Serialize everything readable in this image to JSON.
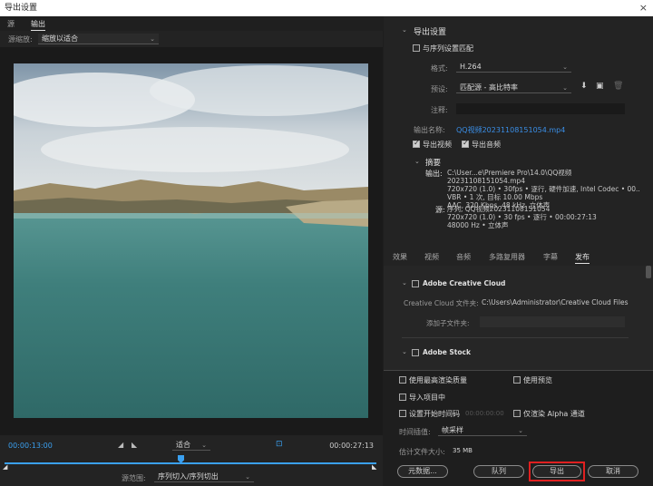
{
  "window": {
    "title": "导出设置",
    "close": "×"
  },
  "left": {
    "tabs": [
      "源",
      "输出"
    ],
    "source_scale_label": "源缩放:",
    "source_scale_value": "缩放以适合",
    "timecode_start": "00:00:13:00",
    "timecode_end": "00:00:27:13",
    "fit_value": "适合",
    "range_label": "源范围:",
    "range_value": "序列切入/序列切出"
  },
  "export": {
    "section_title": "导出设置",
    "match_sequence": "与序列设置匹配",
    "format_label": "格式:",
    "format_value": "H.264",
    "preset_label": "预设:",
    "preset_value": "匹配源 - 高比特率",
    "comment_label": "注释:",
    "output_name_label": "输出名称:",
    "output_name_value": "QQ视频20231108151054.mp4",
    "export_video": "导出视频",
    "export_audio": "导出音频",
    "summary_title": "摘要",
    "output_label": "输出:",
    "output_lines": [
      "C:\\User...e\\Premiere Pro\\14.0\\QQ视频20231108151054.mp4",
      "720x720 (1.0) • 30fps • 逐行, 硬件加速, Intel Codec • 00..",
      "VBR • 1 次, 目标 10.00 Mbps",
      "AAC, 320 Kbps, 48 kHz, 立体声"
    ],
    "source_label": "源:",
    "source_lines": [
      "序列, QQ视频20231108151054",
      "720x720 (1.0) • 30 fps • 逐行 • 00:00:27:13",
      "48000 Hz • 立体声"
    ]
  },
  "subtabs": [
    "效果",
    "视频",
    "音频",
    "多路复用器",
    "字幕",
    "发布"
  ],
  "publish": {
    "cc_title": "Adobe Creative Cloud",
    "cc_folder_label": "Creative Cloud 文件夹:",
    "cc_folder_value": "C:\\Users\\Administrator\\Creative Cloud Files",
    "add_subfolder_label": "添加子文件夹:",
    "stock_title": "Adobe Stock"
  },
  "bottom": {
    "max_render": "使用最高渲染质量",
    "use_preview": "使用预览",
    "import_project": "导入项目中",
    "set_start_tc": "设置开始时间码",
    "start_tc_value": "00:00:00:00",
    "alpha_only": "仅渲染 Alpha 通道",
    "interp_label": "时间插值:",
    "interp_value": "帧采样",
    "filesize_label": "估计文件大小:",
    "filesize_value": "35 MB",
    "metadata_btn": "元数据...",
    "queue_btn": "队列",
    "export_btn": "导出",
    "cancel_btn": "取消"
  },
  "colors": {
    "accent_blue": "#3aa0f0",
    "highlight_red": "#e02020",
    "water": "#3d7d7a"
  }
}
